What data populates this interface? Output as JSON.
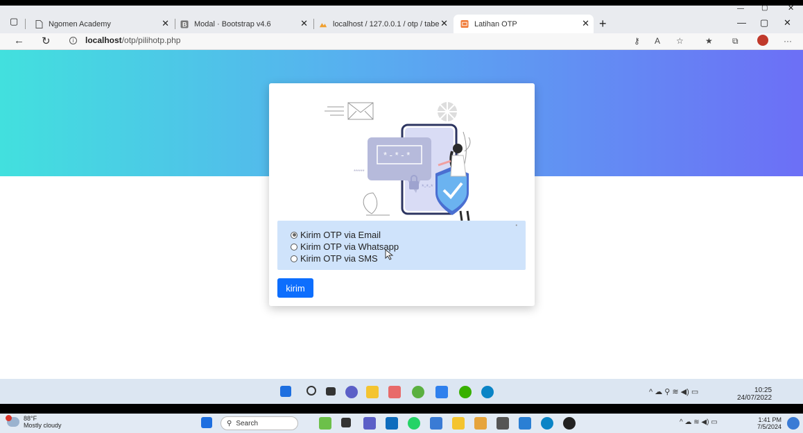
{
  "browser": {
    "tabs": [
      {
        "label": "Ngomen Academy",
        "icon": "page-icon"
      },
      {
        "label": "Modal · Bootstrap v4.6",
        "icon": "bootstrap-icon"
      },
      {
        "label": "localhost / 127.0.0.1 / otp / tabe",
        "icon": "phpmyadmin-icon"
      },
      {
        "label": "Latihan OTP",
        "icon": "otp-icon",
        "active": true
      }
    ],
    "address": {
      "host": "localhost",
      "path": "/otp/pilihotp.php"
    }
  },
  "form": {
    "options": [
      {
        "label": "Kirim OTP via Email",
        "selected": true
      },
      {
        "label": "Kirim OTP via Whatsapp",
        "selected": false
      },
      {
        "label": "Kirim OTP via SMS",
        "selected": false
      }
    ],
    "submit_label": "kirim"
  },
  "inner_taskbar": {
    "time": "10:25",
    "date": "24/07/2022"
  },
  "outer_taskbar": {
    "weather_temp": "88°F",
    "weather_desc": "Mostly cloudy",
    "search_label": "Search",
    "time": "1:41 PM",
    "date": "7/5/2024"
  },
  "colors": {
    "hero_start": "#42e0de",
    "hero_end": "#6c6ff6",
    "button": "#0d6efd",
    "options_bg": "#cfe3fb"
  }
}
